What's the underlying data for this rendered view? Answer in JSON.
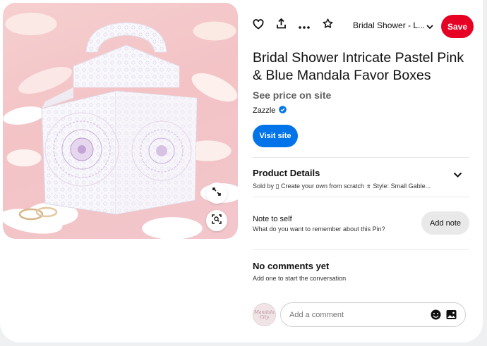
{
  "toolbar": {
    "heart_icon": "heart-icon",
    "share_icon": "share-icon",
    "more_icon": "ellipsis-icon",
    "star_icon": "star-icon",
    "board_label": "Bridal Shower - L...",
    "save_label": "Save",
    "save_color": "#e60023"
  },
  "image": {
    "expand_icon": "expand-icon",
    "visual_search_icon": "visual-search-icon"
  },
  "pin": {
    "title": "Bridal Shower Intricate Pastel Pink & Blue Mandala Favor Boxes",
    "price": "See price on site",
    "source": "Zazzle",
    "visit_label": "Visit site",
    "visit_color": "#0074e8"
  },
  "details": {
    "title": "Product Details",
    "summary": "Sold by ▯ Create your own from scratch  ⌆  Style: Small Gable..."
  },
  "note": {
    "title": "Note to self",
    "prompt": "What do you want to remember about this Pin?",
    "button_label": "Add note"
  },
  "comments": {
    "title": "No comments yet",
    "subtitle": "Add one to start the conversation",
    "placeholder": "Add a comment",
    "avatar_text": "Mandala City"
  }
}
